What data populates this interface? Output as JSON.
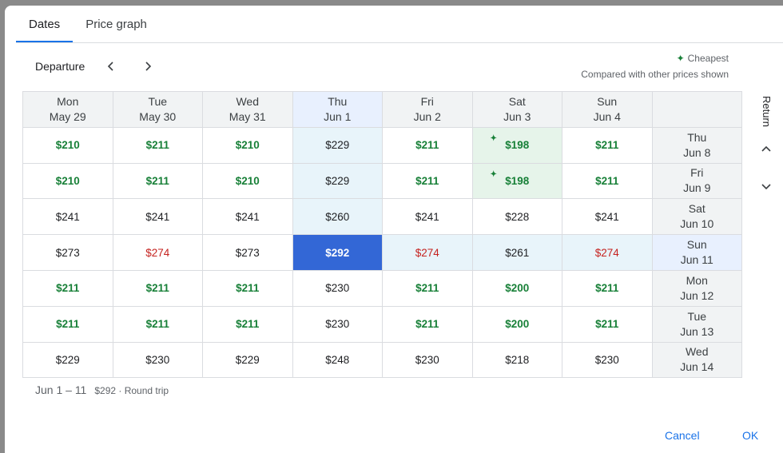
{
  "tabs": [
    "Dates",
    "Price graph"
  ],
  "toolbar": {
    "departure_label": "Departure"
  },
  "legend": {
    "cheapest": "Cheapest",
    "compared": "Compared with other prices shown"
  },
  "return_label": "Return",
  "departure_days": [
    {
      "dow": "Mon",
      "date": "May 29"
    },
    {
      "dow": "Tue",
      "date": "May 30"
    },
    {
      "dow": "Wed",
      "date": "May 31"
    },
    {
      "dow": "Thu",
      "date": "Jun 1"
    },
    {
      "dow": "Fri",
      "date": "Jun 2"
    },
    {
      "dow": "Sat",
      "date": "Jun 3"
    },
    {
      "dow": "Sun",
      "date": "Jun 4"
    }
  ],
  "return_days": [
    {
      "dow": "Thu",
      "date": "Jun 8"
    },
    {
      "dow": "Fri",
      "date": "Jun 9"
    },
    {
      "dow": "Sat",
      "date": "Jun 10"
    },
    {
      "dow": "Sun",
      "date": "Jun 11"
    },
    {
      "dow": "Mon",
      "date": "Jun 12"
    },
    {
      "dow": "Tue",
      "date": "Jun 13"
    },
    {
      "dow": "Wed",
      "date": "Jun 14"
    }
  ],
  "prices": [
    [
      {
        "p": "$210",
        "c": "green"
      },
      {
        "p": "$211",
        "c": "green"
      },
      {
        "p": "$210",
        "c": "green"
      },
      {
        "p": "$229",
        "c": "black"
      },
      {
        "p": "$211",
        "c": "green"
      },
      {
        "p": "$198",
        "c": "green",
        "cheapest": true
      },
      {
        "p": "$211",
        "c": "green"
      }
    ],
    [
      {
        "p": "$210",
        "c": "green"
      },
      {
        "p": "$211",
        "c": "green"
      },
      {
        "p": "$210",
        "c": "green"
      },
      {
        "p": "$229",
        "c": "black"
      },
      {
        "p": "$211",
        "c": "green"
      },
      {
        "p": "$198",
        "c": "green",
        "cheapest": true
      },
      {
        "p": "$211",
        "c": "green"
      }
    ],
    [
      {
        "p": "$241",
        "c": "black"
      },
      {
        "p": "$241",
        "c": "black"
      },
      {
        "p": "$241",
        "c": "black"
      },
      {
        "p": "$260",
        "c": "black"
      },
      {
        "p": "$241",
        "c": "black"
      },
      {
        "p": "$228",
        "c": "black"
      },
      {
        "p": "$241",
        "c": "black"
      }
    ],
    [
      {
        "p": "$273",
        "c": "black"
      },
      {
        "p": "$274",
        "c": "red"
      },
      {
        "p": "$273",
        "c": "black"
      },
      {
        "p": "$292",
        "c": "black"
      },
      {
        "p": "$274",
        "c": "red"
      },
      {
        "p": "$261",
        "c": "black"
      },
      {
        "p": "$274",
        "c": "red"
      }
    ],
    [
      {
        "p": "$211",
        "c": "green"
      },
      {
        "p": "$211",
        "c": "green"
      },
      {
        "p": "$211",
        "c": "green"
      },
      {
        "p": "$230",
        "c": "black"
      },
      {
        "p": "$211",
        "c": "green"
      },
      {
        "p": "$200",
        "c": "green"
      },
      {
        "p": "$211",
        "c": "green"
      }
    ],
    [
      {
        "p": "$211",
        "c": "green"
      },
      {
        "p": "$211",
        "c": "green"
      },
      {
        "p": "$211",
        "c": "green"
      },
      {
        "p": "$230",
        "c": "black"
      },
      {
        "p": "$211",
        "c": "green"
      },
      {
        "p": "$200",
        "c": "green"
      },
      {
        "p": "$211",
        "c": "green"
      }
    ],
    [
      {
        "p": "$229",
        "c": "black"
      },
      {
        "p": "$230",
        "c": "black"
      },
      {
        "p": "$229",
        "c": "black"
      },
      {
        "p": "$248",
        "c": "black"
      },
      {
        "p": "$230",
        "c": "black"
      },
      {
        "p": "$218",
        "c": "black"
      },
      {
        "p": "$230",
        "c": "black"
      }
    ]
  ],
  "selected": {
    "departure_index": 3,
    "return_index": 3
  },
  "summary": {
    "range": "Jun 1 – 11",
    "price": "$292 · Round trip"
  },
  "actions": {
    "cancel": "Cancel",
    "ok": "OK"
  },
  "colors": {
    "accent": "#1a73e8",
    "cheap": "#188038",
    "expensive": "#c5221f",
    "selected_cell": "#3367d6"
  }
}
